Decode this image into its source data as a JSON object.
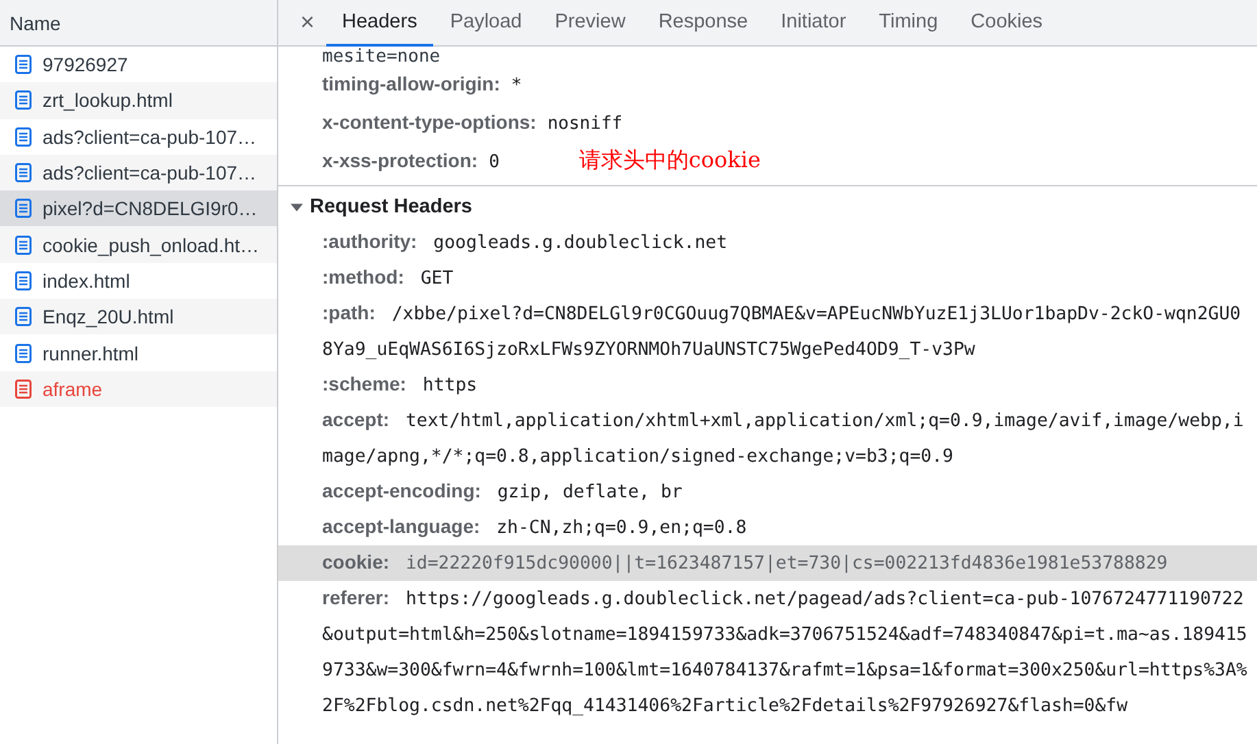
{
  "request_list": {
    "column_header": "Name",
    "items": [
      {
        "name": "97926927",
        "selected": false,
        "failed": false
      },
      {
        "name": "zrt_lookup.html",
        "selected": false,
        "failed": false
      },
      {
        "name": "ads?client=ca-pub-107…",
        "selected": false,
        "failed": false
      },
      {
        "name": "ads?client=ca-pub-107…",
        "selected": false,
        "failed": false
      },
      {
        "name": "pixel?d=CN8DELGI9r0…",
        "selected": true,
        "failed": false
      },
      {
        "name": "cookie_push_onload.ht…",
        "selected": false,
        "failed": false
      },
      {
        "name": "index.html",
        "selected": false,
        "failed": false
      },
      {
        "name": "Enqz_20U.html",
        "selected": false,
        "failed": false
      },
      {
        "name": "runner.html",
        "selected": false,
        "failed": false
      },
      {
        "name": "aframe",
        "selected": false,
        "failed": true
      }
    ]
  },
  "details": {
    "close": "×",
    "tabs": [
      {
        "label": "Headers",
        "selected": true
      },
      {
        "label": "Payload",
        "selected": false
      },
      {
        "label": "Preview",
        "selected": false
      },
      {
        "label": "Response",
        "selected": false
      },
      {
        "label": "Initiator",
        "selected": false
      },
      {
        "label": "Timing",
        "selected": false
      },
      {
        "label": "Cookies",
        "selected": false
      }
    ],
    "response_headers": {
      "continuation": "mesite=none",
      "headers": [
        {
          "name": "timing-allow-origin:",
          "value": "*"
        },
        {
          "name": "x-content-type-options:",
          "value": "nosniff"
        },
        {
          "name": "x-xss-protection:",
          "value": "0"
        }
      ]
    },
    "annotation": "请求头中的cookie",
    "request_headers": {
      "title": "Request Headers",
      "expanded": true,
      "headers": [
        {
          "name": ":authority:",
          "value": "googleads.g.doubleclick.net",
          "highlighted": false
        },
        {
          "name": ":method:",
          "value": "GET",
          "highlighted": false
        },
        {
          "name": ":path:",
          "value": "/xbbe/pixel?d=CN8DELGl9r0CGOuug7QBMAE&v=APEucNWbYuzE1j3LUor1bapDv-2ckO-wqn2GU08Ya9_uEqWAS6I6SjzoRxLFWs9ZYORNMOh7UaUNSTC75WgePed4OD9_T-v3Pw",
          "highlighted": false
        },
        {
          "name": ":scheme:",
          "value": "https",
          "highlighted": false
        },
        {
          "name": "accept:",
          "value": "text/html,application/xhtml+xml,application/xml;q=0.9,image/avif,image/webp,image/apng,*/*;q=0.8,application/signed-exchange;v=b3;q=0.9",
          "highlighted": false
        },
        {
          "name": "accept-encoding:",
          "value": "gzip, deflate, br",
          "highlighted": false
        },
        {
          "name": "accept-language:",
          "value": "zh-CN,zh;q=0.9,en;q=0.8",
          "highlighted": false
        },
        {
          "name": "cookie:",
          "value": "id=22220f915dc90000||t=1623487157|et=730|cs=002213fd4836e1981e53788829",
          "highlighted": true
        },
        {
          "name": "referer:",
          "value": "https://googleads.g.doubleclick.net/pagead/ads?client=ca-pub-1076724771190722&output=html&h=250&slotname=1894159733&adk=3706751524&adf=748340847&pi=t.ma~as.1894159733&w=300&fwrn=4&fwrnh=100&lmt=1640784137&rafmt=1&psa=1&format=300x250&url=https%3A%2F%2Fblog.csdn.net%2Fqq_41431406%2Farticle%2Fdetails%2F97926927&flash=0&fw",
          "highlighted": false
        }
      ]
    }
  }
}
